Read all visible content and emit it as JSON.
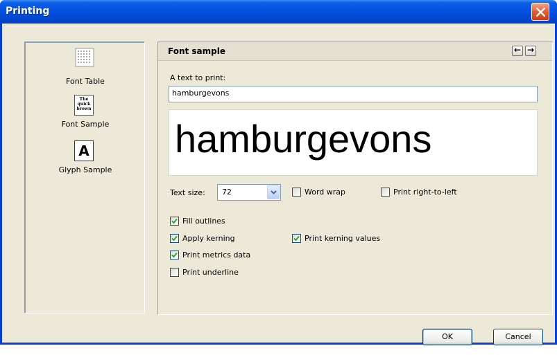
{
  "window": {
    "title": "Printing"
  },
  "sidebar": {
    "items": [
      {
        "label": "Font Table",
        "icon": "font-table-icon"
      },
      {
        "label": "Font Sample",
        "icon": "font-sample-icon",
        "icon_text": "The quick brown"
      },
      {
        "label": "Glyph Sample",
        "icon": "glyph-sample-icon",
        "icon_text": "A"
      }
    ]
  },
  "main": {
    "title": "Font sample",
    "nav": {
      "back_glyph": "←",
      "forward_glyph": "→"
    },
    "text_label": "A text to print:",
    "text_value": "hamburgevons",
    "preview_text": "hamburgevons",
    "text_size_label": "Text size:",
    "text_size_value": "72",
    "checkboxes": {
      "word_wrap": {
        "label": "Word wrap",
        "checked": false
      },
      "print_rtl": {
        "label": "Print right-to-left",
        "checked": false
      },
      "fill_outlines": {
        "label": "Fill outlines",
        "checked": true
      },
      "apply_kerning": {
        "label": "Apply kerning",
        "checked": true
      },
      "print_kerning_values": {
        "label": "Print kerning values",
        "checked": true
      },
      "print_metrics_data": {
        "label": "Print metrics data",
        "checked": true
      },
      "print_underline": {
        "label": "Print underline",
        "checked": false
      }
    }
  },
  "footer": {
    "ok_label": "OK",
    "cancel_label": "Cancel"
  },
  "colors": {
    "titlebar": "#0551e0",
    "dialog_bg": "#ece9d8",
    "check": "#21a121"
  }
}
